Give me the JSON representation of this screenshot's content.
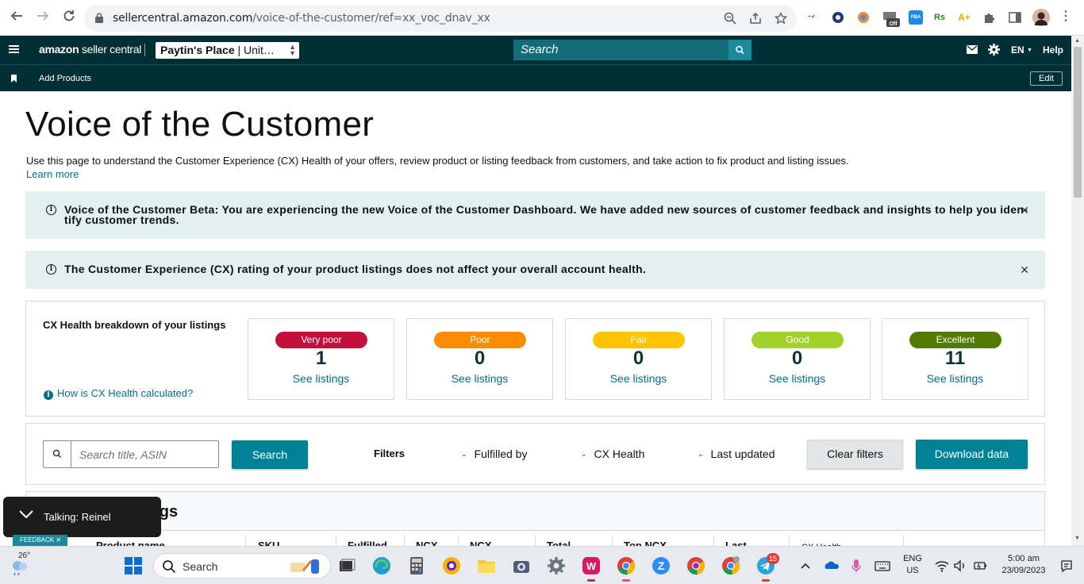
{
  "browser": {
    "url_host": "sellercentral.amazon.com",
    "url_path": "/voice-of-the-customer/ref=xx_voc_dnav_xx",
    "extension_label_rs": "Rs",
    "extension_label_fba": "FBA",
    "extension_label_off": "Off"
  },
  "header": {
    "logo_amazon": "amazon",
    "logo_suffix": " seller central",
    "store_name": "Paytin's Place",
    "store_suffix": " | Unit…",
    "search_placeholder": "Search",
    "language": "EN",
    "help": "Help",
    "bookmark_label": "Add Products",
    "edit_label": "Edit"
  },
  "page": {
    "title": "Voice of the Customer",
    "intro": "Use this page to understand the Customer Experience (CX) Health of your offers, review product or listing feedback from customers, and take action to fix product and listing issues.",
    "learn_more": "Learn more",
    "alert_beta_line1": "Voice of the Customer Beta: You are experiencing the new Voice of the Customer Dashboard. We have added new sources of customer feedback and insights to help you iden-",
    "alert_beta_line2": "tify customer trends.",
    "alert_cx": "The Customer Experience (CX) rating of your product listings does not affect your overall account health."
  },
  "cx_health": {
    "heading": "CX Health breakdown of your listings",
    "how_link": "How is CX Health calculated?",
    "tiles": [
      {
        "label": "Very poor",
        "count": "1",
        "link": "See listings",
        "color": "#c40f3c"
      },
      {
        "label": "Poor",
        "count": "0",
        "link": "See listings",
        "color": "#ff8c00"
      },
      {
        "label": "Fair",
        "count": "0",
        "link": "See listings",
        "color": "#ffc400"
      },
      {
        "label": "Good",
        "count": "0",
        "link": "See listings",
        "color": "#a2d12a"
      },
      {
        "label": "Excellent",
        "count": "11",
        "link": "See listings",
        "color": "#507a00"
      }
    ]
  },
  "filters": {
    "search_placeholder": "Search title, ASIN",
    "search_button": "Search",
    "filters_label": "Filters",
    "fulfilled_by": "Fulfilled by",
    "cx_health": "CX Health",
    "last_updated": "Last updated",
    "clear_filters": "Clear filters",
    "download_data": "Download data"
  },
  "listings": {
    "title_fragment": "ings",
    "columns": [
      "Product name",
      "SKU",
      "Fulfilled",
      "NCX",
      "NCX",
      "Total",
      "Top NCX",
      "Last",
      "CX Health"
    ]
  },
  "overlays": {
    "talking": "Talking: Reinel",
    "feedback": "FEEDBACK"
  },
  "taskbar": {
    "weather_temp": "26°",
    "search_label": "Search",
    "lang_line1": "ENG",
    "lang_line2": "US",
    "time": "5:00 am",
    "date": "23/09/2023",
    "telegram_badge": "15"
  }
}
